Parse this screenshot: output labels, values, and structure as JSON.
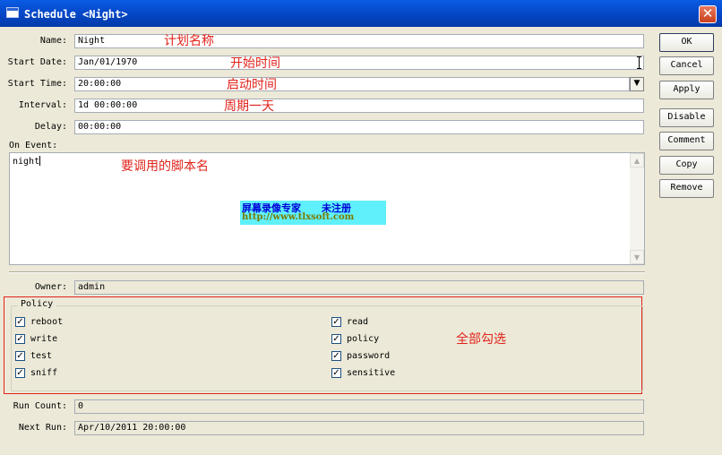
{
  "window": {
    "title": "Schedule <Night>",
    "close_symbol": "✕"
  },
  "fields": {
    "name": {
      "label": "Name:",
      "value": "Night"
    },
    "start_date": {
      "label": "Start Date:",
      "value": "Jan/01/1970"
    },
    "start_time": {
      "label": "Start Time:",
      "value": "20:00:00"
    },
    "interval": {
      "label": "Interval:",
      "value": "1d 00:00:00"
    },
    "delay": {
      "label": "Delay:",
      "value": "00:00:00"
    },
    "on_event": {
      "label": "On Event:",
      "value": "night"
    },
    "owner": {
      "label": "Owner:",
      "value": "admin"
    },
    "run_count": {
      "label": "Run Count:",
      "value": "0"
    },
    "next_run": {
      "label": "Next Run:",
      "value": "Apr/10/2011 20:00:00"
    }
  },
  "annotations": {
    "name": "计划名称",
    "start_date": "开始时间",
    "start_time": "启动时间",
    "interval": "周期一天",
    "on_event": "要调用的脚本名",
    "policy": "全部勾选"
  },
  "watermark": {
    "line1": "屏幕录像专家      未注册",
    "line2": "http://www.tlxsoft.com"
  },
  "policy": {
    "legend": "Policy",
    "left": [
      {
        "label": "reboot",
        "checked": true
      },
      {
        "label": "write",
        "checked": true
      },
      {
        "label": "test",
        "checked": true
      },
      {
        "label": "sniff",
        "checked": true
      }
    ],
    "right": [
      {
        "label": "read",
        "checked": true
      },
      {
        "label": "policy",
        "checked": true
      },
      {
        "label": "password",
        "checked": true
      },
      {
        "label": "sensitive",
        "checked": true
      }
    ],
    "check_symbol": "✓"
  },
  "buttons": {
    "ok": "OK",
    "cancel": "Cancel",
    "apply": "Apply",
    "disable": "Disable",
    "comment": "Comment",
    "copy": "Copy",
    "remove": "Remove"
  },
  "icons": {
    "dropdown": "▼",
    "scroll_up": "▲",
    "scroll_down": "▼"
  },
  "colors": {
    "annotation": "#e0231b",
    "titlebar": "#0447c7",
    "window_bg": "#ece9d8"
  }
}
